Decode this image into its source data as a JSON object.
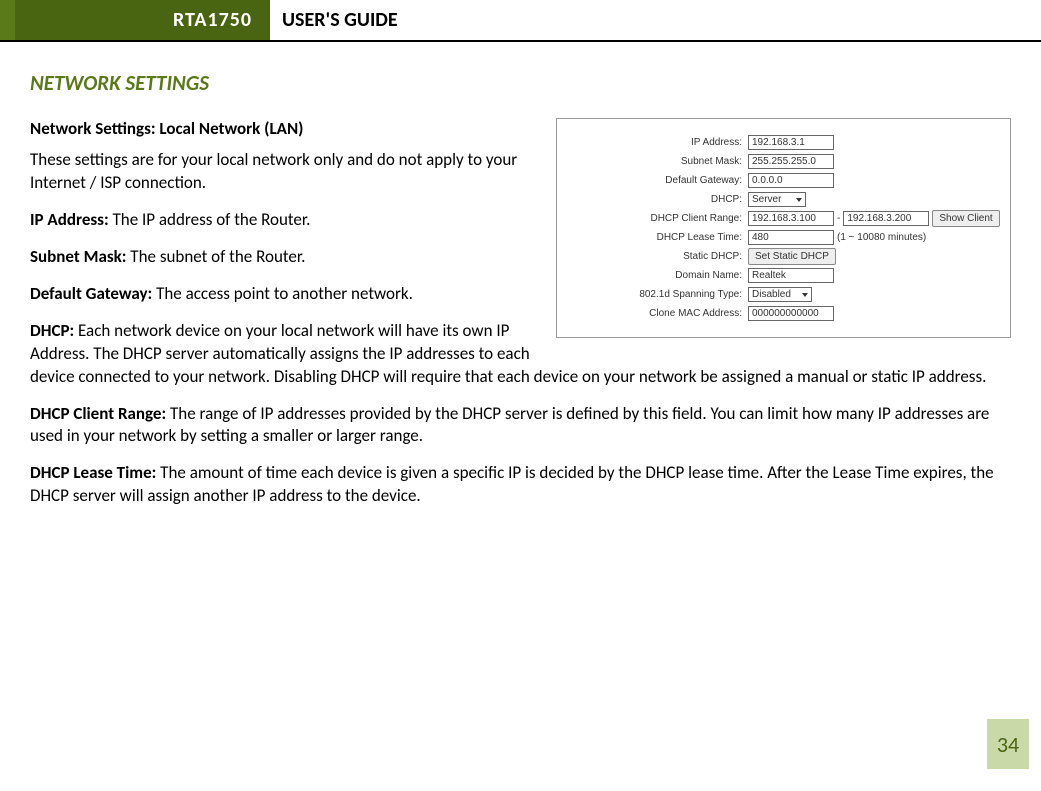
{
  "header": {
    "model": "RTA1750",
    "guide": "USER'S GUIDE"
  },
  "section_title": "NETWORK SETTINGS",
  "sub_heading": "Network Settings: Local Network (LAN)",
  "intro": "These settings are for your local network only and do not apply to your Internet / ISP connection.",
  "defs": {
    "ip": {
      "label": "IP Address:",
      "text": " The IP address of the Router."
    },
    "mask": {
      "label": "Subnet Mask:",
      "text": " The subnet of the Router."
    },
    "gw": {
      "label": "Default Gateway:",
      "text": " The access point to another network."
    },
    "dhcp": {
      "label": "DHCP:",
      "text": " Each network device on your local network will have its own IP Address.  The DHCP server automatically assigns the IP addresses to each device connected to your network.  Disabling DHCP will require that each device on your network be assigned a manual or static IP address."
    },
    "range": {
      "label": "DHCP Client Range:",
      "text": " The range of IP addresses provided by the DHCP server is defined by this field.  You can limit how many IP addresses are used in your network by setting a smaller or larger range."
    },
    "lease": {
      "label": "DHCP Lease Time:",
      "text": " The amount of time each device is given a specific IP is decided by the DHCP lease time.  After the Lease Time expires, the DHCP server will assign another IP address to the device."
    }
  },
  "figure": {
    "rows": {
      "ip": {
        "label": "IP Address:",
        "value": "192.168.3.1"
      },
      "mask": {
        "label": "Subnet Mask:",
        "value": "255.255.255.0"
      },
      "gw": {
        "label": "Default Gateway:",
        "value": "0.0.0.0"
      },
      "dhcp": {
        "label": "DHCP:",
        "value": "Server"
      },
      "range": {
        "label": "DHCP Client Range:",
        "from": "192.168.3.100",
        "dash": " - ",
        "to": "192.168.3.200",
        "btn": "Show Client"
      },
      "lease": {
        "label": "DHCP Lease Time:",
        "value": "480",
        "note": "(1 ~ 10080 minutes)"
      },
      "static": {
        "label": "Static DHCP:",
        "btn": "Set Static DHCP"
      },
      "domain": {
        "label": "Domain Name:",
        "value": "Realtek"
      },
      "spanning": {
        "label": "802.1d Spanning Type:",
        "value": "Disabled"
      },
      "mac": {
        "label": "Clone MAC Address:",
        "value": "000000000000"
      }
    }
  },
  "page_number": "34"
}
